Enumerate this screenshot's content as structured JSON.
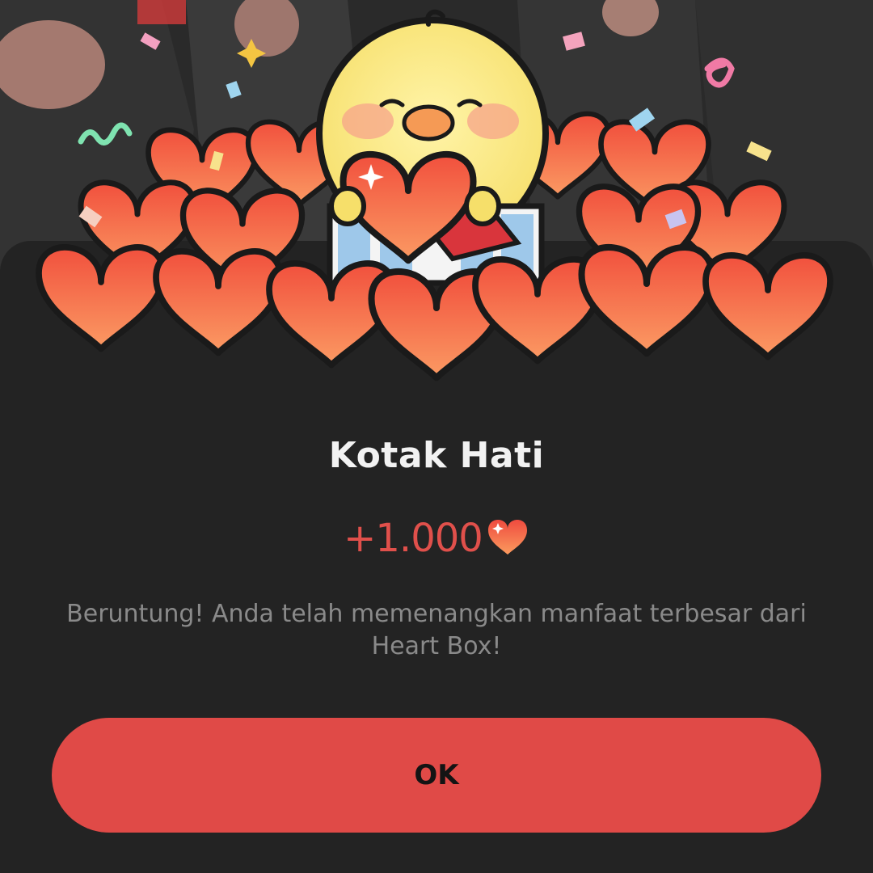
{
  "dialog": {
    "title": "Kotak Hati",
    "reward_amount": "+1.000",
    "reward_icon": "heart-icon",
    "message": "Beruntung! Anda telah memenangkan manfaat terbesar dari Heart Box!",
    "ok_label": "OK"
  },
  "illustration": {
    "subject": "yellow chick holding a heart on a gift box surrounded by hearts and confetti",
    "heart_color": "#f2603f",
    "chick_color": "#fbe77a"
  },
  "colors": {
    "accent": "#e04a47",
    "reward_text": "#e0504b",
    "background": "#232323",
    "title_text": "#f2f2f2",
    "message_text": "#8a8a8a"
  }
}
